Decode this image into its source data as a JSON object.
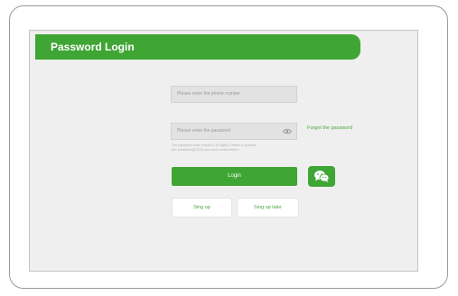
{
  "header": {
    "title": "Password Login"
  },
  "form": {
    "phone_placeholder": "Please enter the phone number",
    "password_placeholder": "Please enter the password",
    "forgot_label": "Forget the password",
    "hint_lines": [
      "The password must contain 8-16 digits & letters & symbols",
      "(ex: password@1234) and must contain letters"
    ],
    "login_label": "Login",
    "signup_label": "Sing up",
    "signup_later_label": "Sing up later"
  },
  "icons": {
    "eye": "eye-icon",
    "wechat": "wechat-icon"
  },
  "colors": {
    "accent": "#3fa535",
    "link": "#4aa83f",
    "screen_bg": "#efefef",
    "field_bg": "#e2e2e2"
  }
}
